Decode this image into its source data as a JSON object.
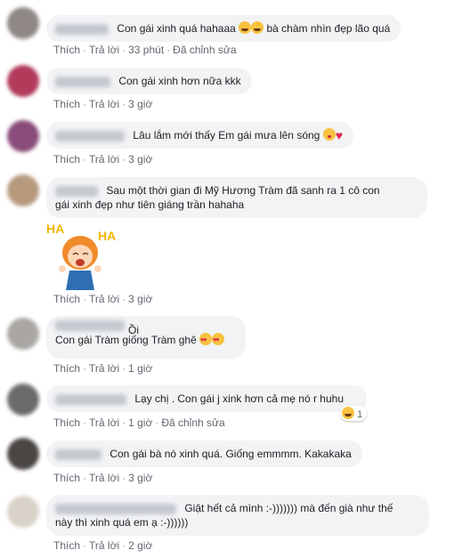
{
  "actions": {
    "like": "Thích",
    "reply": "Trả lời",
    "edited": "Đã chỉnh sửa",
    "separator": "·"
  },
  "comments": [
    {
      "text": "Con gái xinh quá hahaaa",
      "text2": "bà chàm nhìn đẹp lão quá",
      "time": "33 phút",
      "edited": true
    },
    {
      "text": "Con gái xinh hơn nữa kkk",
      "time": "3 giờ"
    },
    {
      "text": "Lâu lắm mới thấy Em gái mưa lên sóng",
      "time": "3 giờ"
    },
    {
      "line1": "Sau một thời gian đi Mỹ Hương Tràm đã sanh ra 1 cô con",
      "line2": "gái xinh đẹp như tiên giáng trần hahaha",
      "sticker_text_left": "HA",
      "sticker_text_right": "HA",
      "time": "3 giờ"
    },
    {
      "line1": "Ồi",
      "line2": "Con gái Tràm giống Tràm ghê",
      "time": "1 giờ"
    },
    {
      "text": "Lạy chị . Con gái j xink hơn cả mẹ nó r huhu",
      "time": "1 giờ",
      "edited": true,
      "reaction_count": "1"
    },
    {
      "text": "Con gái bà nó xinh quá. Giống emmmm. Kakakaka",
      "time": "3 giờ"
    },
    {
      "line1": "Giật hết cả mình :-))))))) mà đến già như thế",
      "line2": "này thì xinh quá em ạ :-))))))",
      "time": "2 giờ"
    }
  ]
}
